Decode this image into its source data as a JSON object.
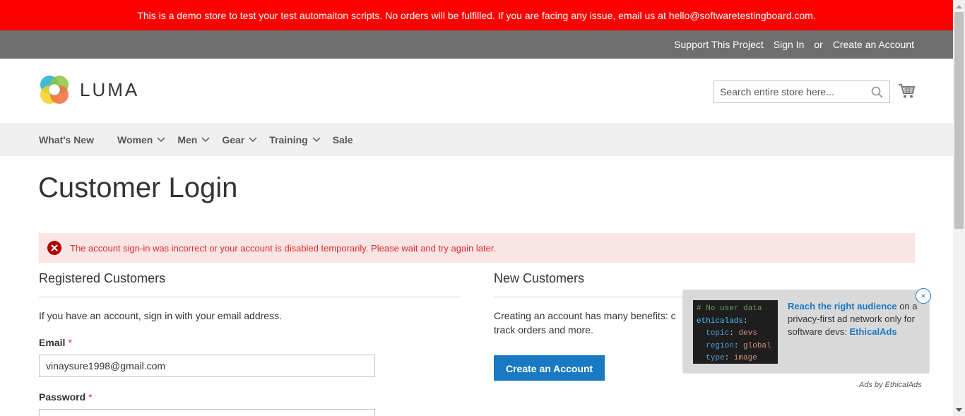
{
  "banner": {
    "text": "This is a demo store to test your test automaiton scripts. No orders will be fulfilled. If you are facing any issue, email us at hello@softwaretestingboard.com."
  },
  "panel": {
    "support": "Support This Project",
    "sign_in": "Sign In",
    "or": "or",
    "create_account": "Create an Account"
  },
  "logo": {
    "text": "LUMA"
  },
  "search": {
    "placeholder": "Search entire store here..."
  },
  "nav": {
    "items": [
      {
        "label": "What's New",
        "has_dropdown": false
      },
      {
        "label": "Women",
        "has_dropdown": true
      },
      {
        "label": "Men",
        "has_dropdown": true
      },
      {
        "label": "Gear",
        "has_dropdown": true
      },
      {
        "label": "Training",
        "has_dropdown": true
      },
      {
        "label": "Sale",
        "has_dropdown": false
      }
    ]
  },
  "page": {
    "title": "Customer Login"
  },
  "error": {
    "text": "The account sign-in was incorrect or your account is disabled temporarily. Please wait and try again later."
  },
  "registered": {
    "title": "Registered Customers",
    "intro": "If you have an account, sign in with your email address.",
    "email_label": "Email",
    "email_value": "vinaysure1998@gmail.com",
    "password_label": "Password",
    "required_mark": "*"
  },
  "new_customers": {
    "title": "New Customers",
    "text": "Creating an account has many benefits: c",
    "text2": "track orders and more.",
    "button": "Create an Account"
  },
  "ad": {
    "code_comment": "# No user data",
    "code_key": "ethicalads",
    "code_colon": ":",
    "topic_key": "topic",
    "topic_val": "devs",
    "region_key": "region",
    "region_val": "global",
    "type_key": "type",
    "type_val": "image",
    "headline": "Reach the right audience",
    "body_on": " on",
    "body": "a privacy-first ad network only for software devs:",
    "brand": "EthicalAds",
    "close": "×",
    "by": "Ads by EthicalAds"
  },
  "colors": {
    "banner": "#ff0000",
    "panel": "#6e6e6e",
    "nav": "#f0f0f0",
    "primary": "#1979c3",
    "error_bg": "#fae5e5",
    "error_text": "#e02b27"
  }
}
